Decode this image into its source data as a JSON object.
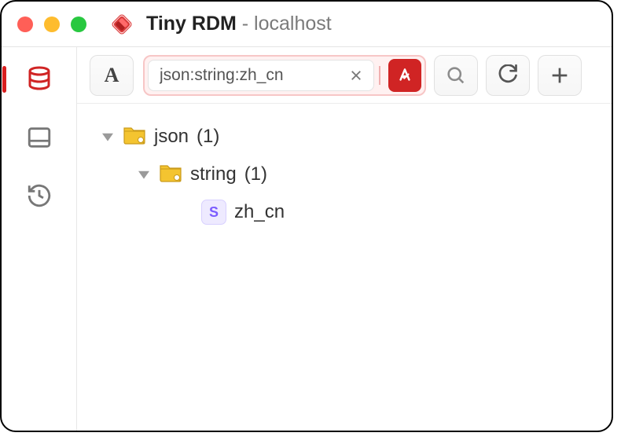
{
  "window": {
    "app_name": "Tiny RDM",
    "subtitle": "- localhost"
  },
  "toolbar": {
    "mode_label": "A",
    "filter_value": "json:string:zh_cn"
  },
  "tree": {
    "root": {
      "label": "json",
      "count": "(1)"
    },
    "child": {
      "label": "string",
      "count": "(1)"
    },
    "key": {
      "type_letter": "S",
      "name": "zh_cn"
    }
  }
}
